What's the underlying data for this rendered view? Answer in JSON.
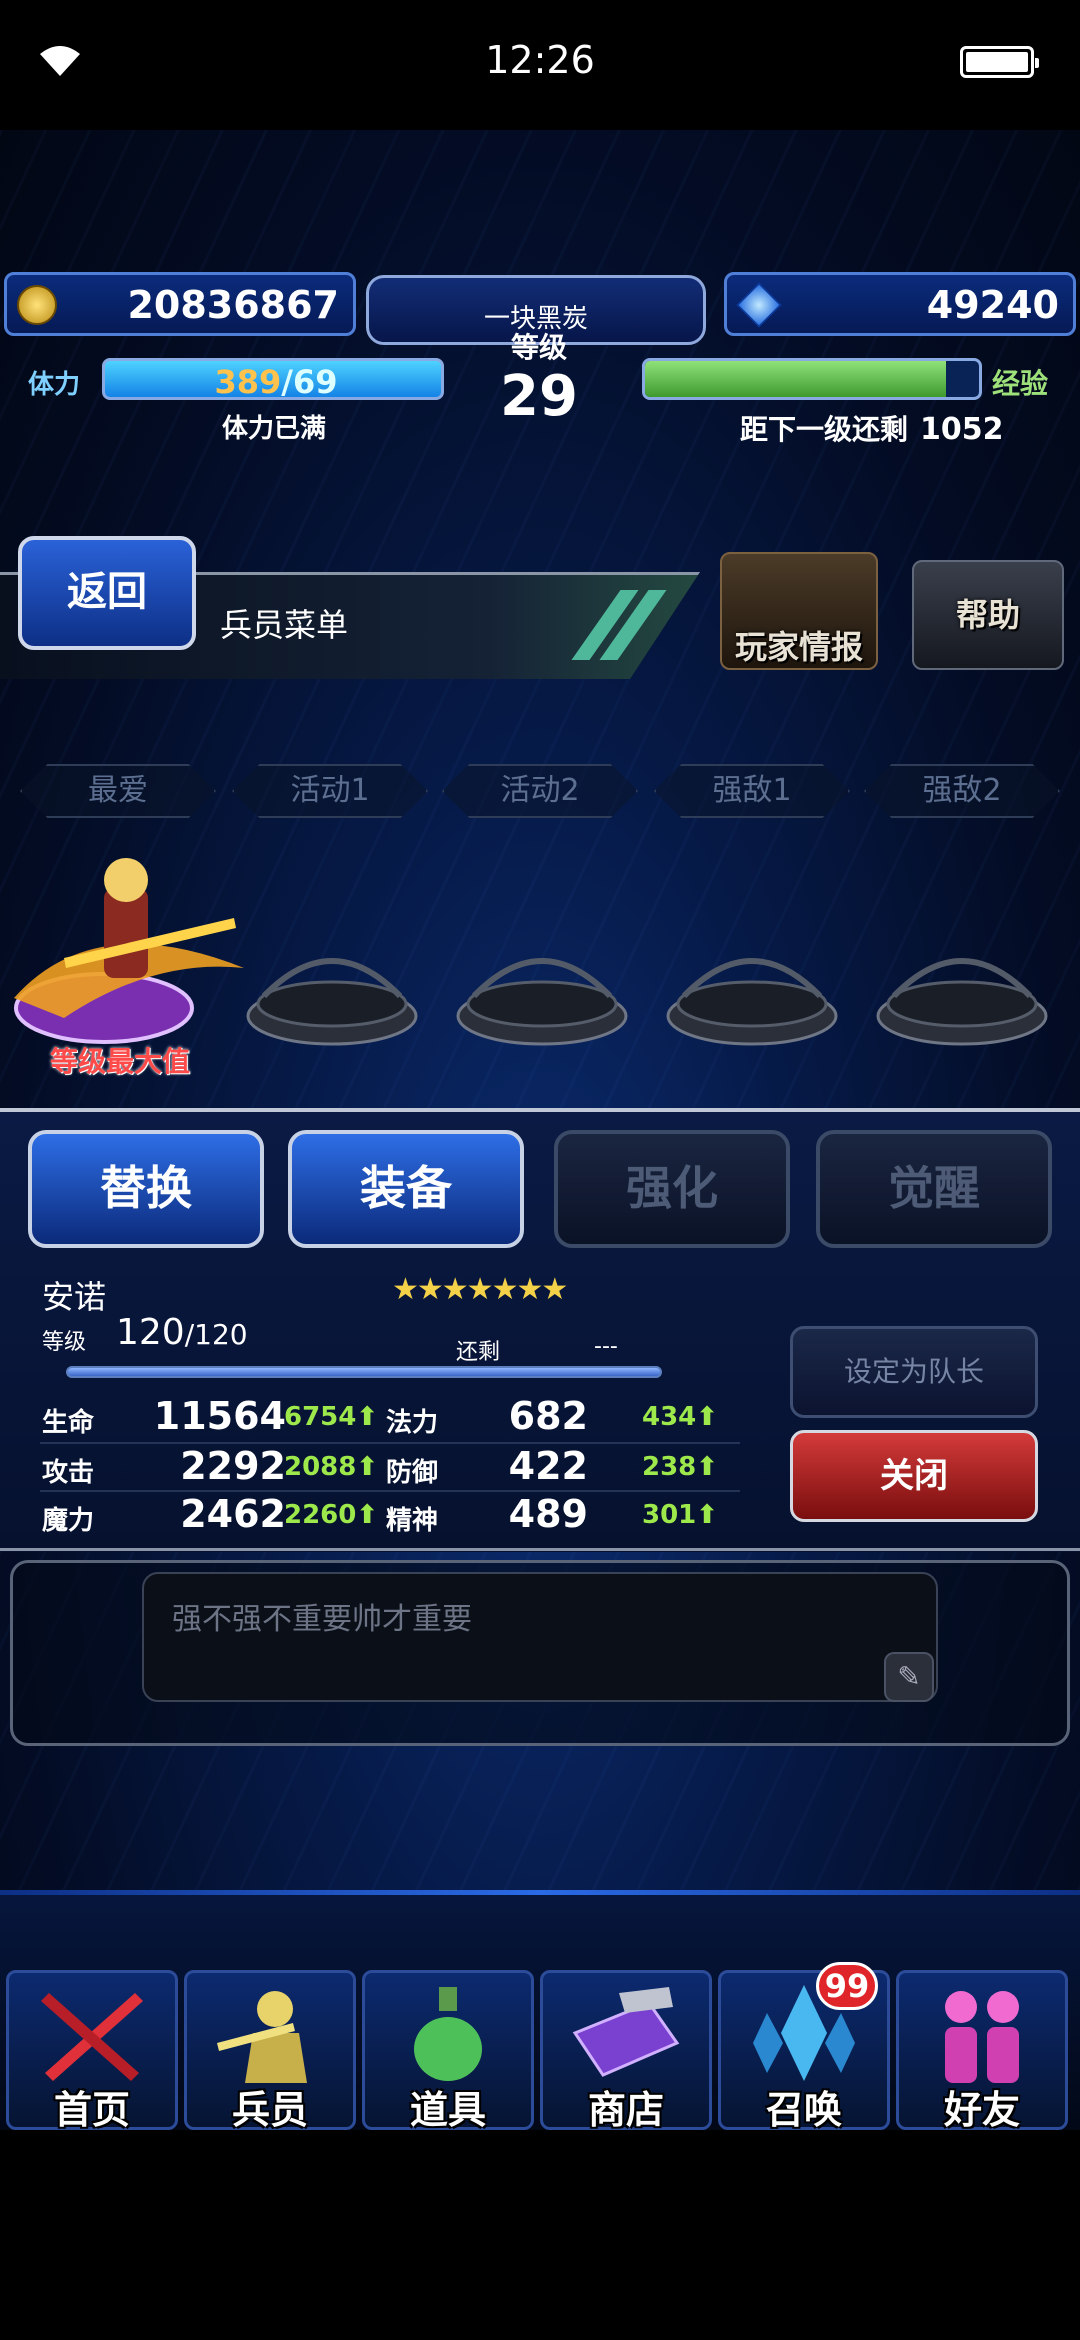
{
  "status_bar": {
    "time": "12:26"
  },
  "hud": {
    "gold": "20836867",
    "gems": "49240",
    "player_name": "一块黑炭",
    "level_label": "等级",
    "level": "29",
    "stamina_label": "体力",
    "stamina_current": "389",
    "stamina_max": "/69",
    "stamina_status": "体力已满",
    "exp_label": "经验",
    "exp_fill": 0.9,
    "exp_remaining_label": "距下一级还剩",
    "exp_remaining": "1052"
  },
  "header": {
    "back_label": "返回",
    "menu_title": "兵员菜单",
    "player_info_label": "玩家情报",
    "help_label": "帮助"
  },
  "tabs": [
    "最爱",
    "活动1",
    "活动2",
    "强敌1",
    "强敌2"
  ],
  "party": {
    "max_level_badge": "等级最大值"
  },
  "actions": {
    "replace": "替换",
    "equip": "装备",
    "enhance": "强化",
    "awaken": "觉醒"
  },
  "unit": {
    "name": "安诺",
    "stars": "★★★★★★★",
    "level_label": "等级",
    "level": "120",
    "level_max": "/120",
    "remaining_label": "还剩",
    "remaining_value": "---",
    "stats": [
      {
        "label": "生命",
        "value": "11564",
        "bonus": "6754",
        "label2": "法力",
        "value2": "682",
        "bonus2": "434"
      },
      {
        "label": "攻击",
        "value": "2292",
        "bonus": "2088",
        "label2": "防御",
        "value2": "422",
        "bonus2": "238"
      },
      {
        "label": "魔力",
        "value": "2462",
        "bonus": "2260",
        "label2": "精神",
        "value2": "489",
        "bonus2": "301"
      }
    ],
    "set_leader_label": "设定为队长",
    "close_label": "关闭"
  },
  "comment": {
    "text": "强不强不重要帅才重要"
  },
  "nav": {
    "items": [
      {
        "label": "首页",
        "icon": "crossed-swords-icon"
      },
      {
        "label": "兵员",
        "icon": "unit-hero-icon"
      },
      {
        "label": "道具",
        "icon": "potion-icon"
      },
      {
        "label": "商店",
        "icon": "shop-icon"
      },
      {
        "label": "召唤",
        "icon": "crystal-icon"
      },
      {
        "label": "好友",
        "icon": "friends-icon"
      }
    ],
    "summon_badge": "99"
  },
  "colors": {
    "accent": "#2a6ae6",
    "close_red": "#d43a3a",
    "bonus_green": "#9de84a",
    "gold": "#f3d24a"
  }
}
